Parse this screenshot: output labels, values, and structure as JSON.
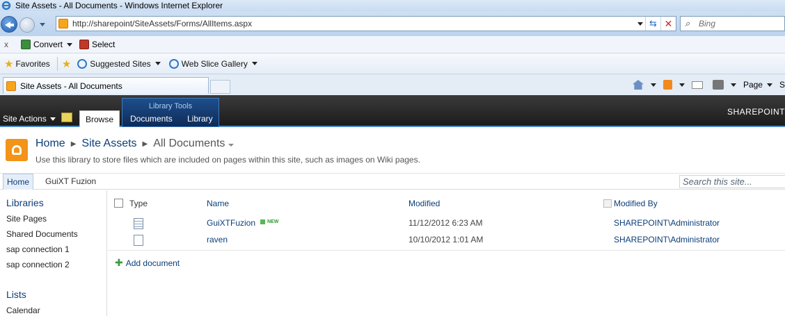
{
  "browser": {
    "window_title": "Site Assets - All Documents - Windows Internet Explorer",
    "url": "http://sharepoint/SiteAssets/Forms/AllItems.aspx",
    "search_placeholder": "Bing",
    "command_bar": {
      "close": "x",
      "convert": "Convert",
      "select": "Select"
    },
    "favorites_bar": {
      "favorites": "Favorites",
      "suggested_sites": "Suggested Sites",
      "web_slice_gallery": "Web Slice Gallery"
    },
    "tab_title": "Site Assets - All Documents",
    "tools": {
      "page": "Page",
      "safety": "S"
    }
  },
  "ribbon": {
    "site_actions": "Site Actions",
    "browse_tab": "Browse",
    "library_tools_title": "Library Tools",
    "documents_tab": "Documents",
    "library_tab": "Library",
    "brand": "SHAREPOINT"
  },
  "header": {
    "breadcrumb": {
      "home": "Home",
      "site_assets": "Site Assets",
      "current": "All Documents"
    },
    "description": "Use this library to store files which are included on pages within this site, such as images on Wiki pages."
  },
  "top_nav": {
    "home": "Home",
    "guixt_fuzion": "GuiXT Fuzion",
    "search_placeholder": "Search this site..."
  },
  "quick_launch": {
    "libraries_heading": "Libraries",
    "libraries": [
      "Site Pages",
      "Shared Documents",
      "sap connection 1",
      "sap connection 2"
    ],
    "lists_heading": "Lists",
    "lists": [
      "Calendar"
    ]
  },
  "list": {
    "columns": {
      "type": "Type",
      "name": "Name",
      "modified": "Modified",
      "modified_by": "Modified By"
    },
    "rows": [
      {
        "name": "GuiXTFuzion",
        "badge": "NEW",
        "modified": "11/12/2012 6:23 AM",
        "modified_by": "SHAREPOINT\\Administrator"
      },
      {
        "name": "raven",
        "badge": "",
        "modified": "10/10/2012 1:01 AM",
        "modified_by": "SHAREPOINT\\Administrator"
      }
    ],
    "add_document": "Add document"
  }
}
